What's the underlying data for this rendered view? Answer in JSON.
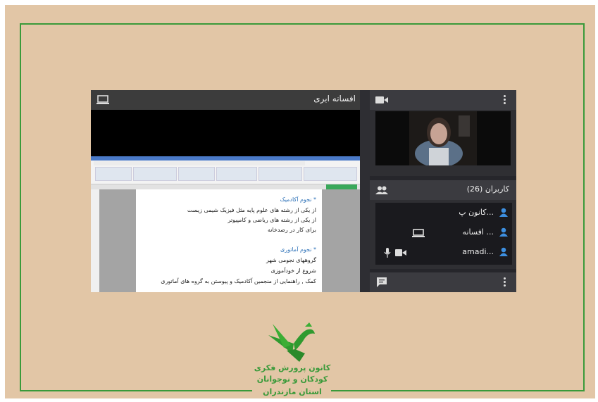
{
  "presentation": {
    "title": "افسانه ابری",
    "icon": "laptop-icon",
    "doc_lines": [
      {
        "text": "* نجوم آکادمیک",
        "heading": true
      },
      {
        "text": "از یکی از رشته های علوم پایه مثل فیزیک شیمی زیست",
        "heading": false
      },
      {
        "text": "از یکی از رشته های ریاضی و کامپیوتر",
        "heading": false
      },
      {
        "text": "برای کار در رصدخانه",
        "heading": false
      },
      {
        "text": "* نجوم آماتوری",
        "heading": true
      },
      {
        "text": "گروههای نجومی شهر",
        "heading": false
      },
      {
        "text": "شروع از خودآموزی",
        "heading": false
      },
      {
        "text": "کمک , راهنمایی از منجمین آکادمیک و پیوستن به گروه های آماتوری",
        "heading": false
      }
    ]
  },
  "camera": {
    "icon": "video-camera-icon",
    "menu_icon": "kebab-menu-icon"
  },
  "users": {
    "title": "کاربران (26)",
    "icon": "users-icon",
    "list": [
      {
        "name": "کانون پ...",
        "extras": []
      },
      {
        "name": "افسانه ...",
        "extras": [
          "laptop-icon"
        ]
      },
      {
        "name": "amadi...",
        "extras": [
          "microphone-icon",
          "video-camera-icon"
        ]
      }
    ]
  },
  "chat": {
    "icon": "chat-icon",
    "menu_icon": "kebab-menu-icon"
  },
  "logo": {
    "line1": "کانون پرورش فکری",
    "line2": "کودکان و نوجوانان",
    "line3": "استان مازندران"
  },
  "colors": {
    "frame_green": "#3a9a3a",
    "background_beige": "#e2c6a6",
    "user_blue": "#3d8fe0"
  }
}
